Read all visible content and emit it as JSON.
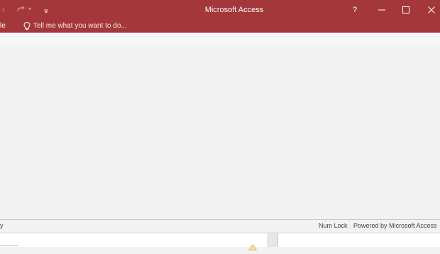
{
  "titlebar": {
    "title": "Microsoft Access",
    "help_label": "?",
    "undo_glyph": "‹",
    "redo_dropdown_glyph": "▾"
  },
  "tellbar": {
    "file_tab_label": "le",
    "tell_me_text": "Tell me what you want to do..."
  },
  "statusbar": {
    "left_text": "y",
    "num_lock": "Num Lock",
    "powered_by": "Powered by Microsoft Access"
  },
  "colors": {
    "accent": "#a4373a",
    "workspace": "#f3f2f3",
    "warning": "#e8b34a"
  },
  "icons": [
    "undo-icon",
    "redo-icon",
    "customize-qat-icon",
    "lightbulb-icon",
    "minimize-icon",
    "maximize-icon",
    "close-icon",
    "warning-icon"
  ]
}
